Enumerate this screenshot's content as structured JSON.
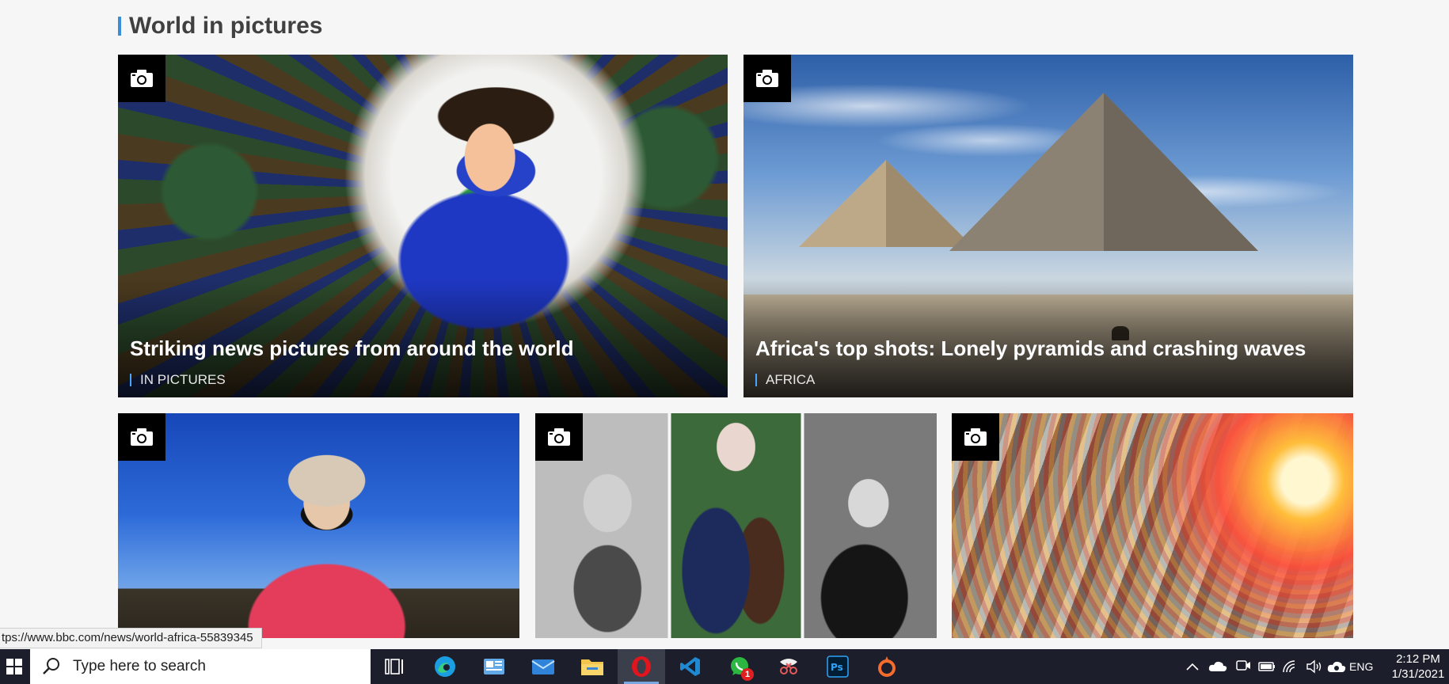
{
  "section": {
    "title": "World in pictures"
  },
  "cards": [
    {
      "headline": "Striking news pictures from around the world",
      "tag": "IN PICTURES"
    },
    {
      "headline": "Africa's top shots: Lonely pyramids and crashing waves",
      "tag": "AFRICA"
    },
    {
      "headline": "",
      "tag": ""
    },
    {
      "headline": "",
      "tag": ""
    },
    {
      "headline": "",
      "tag": ""
    }
  ],
  "status_url": "tps://www.bbc.com/news/world-africa-55839345",
  "taskbar": {
    "search_placeholder": "Type here to search",
    "apps": [
      "task-view",
      "edge",
      "news",
      "mail",
      "file-explorer",
      "opera",
      "vscode",
      "whatsapp",
      "snip-sketch",
      "photoshop",
      "origin"
    ],
    "active_app": "opera",
    "whatsapp_badge": "1",
    "language": "ENG",
    "time": "2:12 PM",
    "date": "1/31/2021"
  },
  "colors": {
    "accent": "#3b8dd8",
    "taskbar": "#1c1f2b",
    "page_bg": "#f6f6f6"
  }
}
